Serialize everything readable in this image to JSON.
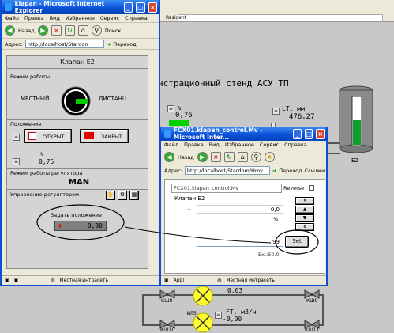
{
  "bg": {
    "title_fragment": "нстрационный стенд АСУ ТП",
    "label_resident": "Resident",
    "tag_76": "0,76",
    "pct": "%",
    "lt_label": "LT, мм",
    "lt_value": "476,27",
    "tank_name": "E2",
    "flow_value": "0,03",
    "il5": "ИЛ5",
    "ft_label": "FT, м3/ч",
    "ft_value": "-0,00",
    "valves": [
      "КШ8",
      "КШ9",
      "КШ10",
      "КШ11"
    ]
  },
  "left": {
    "title": "klapan - Microsoft Internet Explorer",
    "menu": [
      "Файл",
      "Правка",
      "Вид",
      "Избранное",
      "Сервис",
      "Справка"
    ],
    "back": "Назад",
    "search": "Поиск",
    "addr_label": "Адрес:",
    "addr_value": "http://localhost/Stardon",
    "go": "Переход",
    "header": "Клапан E2",
    "mode_label": "Режим работы",
    "local": "МЕСТНЫЙ",
    "remote": "ДИСТАНЦ",
    "position_label": "Положение",
    "open": "ОТКРЫТ",
    "closed": "ЗАКРЫТ",
    "pct": "%",
    "pos_value": "0,75",
    "reg_mode_label": "Режим работы регулятора",
    "reg_mode": "MAN",
    "reg_ctrl_label": "Управление регулятором",
    "set_pos_label": "Задать положение",
    "set_pos_value": "0,00",
    "status": "Местная интрасеть"
  },
  "popup": {
    "title": "FCX01.klapan_control.Mv - Microsoft Inter...",
    "menu": [
      "Файл",
      "Правка",
      "Вид",
      "Избранное",
      "Сервис",
      "Справка"
    ],
    "back": "Назад",
    "addr_label": "Адрес:",
    "addr_value": "http://localhost/Stardom/Hmy",
    "go": "Переход",
    "links": "Ссылки",
    "tag": "FCX01.klapan_control.Mv",
    "reverse": "Reverse",
    "valve": "Клапан E2",
    "value": "0,0",
    "pct": "%",
    "input_value": "99",
    "set_button": "Set",
    "range": "Ex.:50.0",
    "status_left": "Appl",
    "status": "Местная интрасеть"
  }
}
